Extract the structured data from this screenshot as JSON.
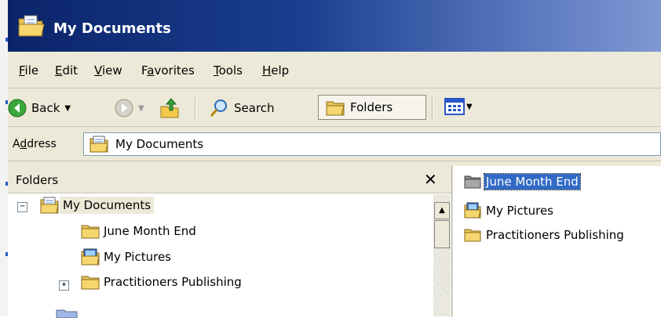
{
  "window": {
    "title": "My Documents",
    "title_icon": "folder-open-icon"
  },
  "menu": {
    "file": {
      "u": "F",
      "rest": "ile"
    },
    "edit": {
      "u": "E",
      "rest": "dit"
    },
    "view": {
      "u": "V",
      "rest": "iew"
    },
    "favorites": {
      "pre": "F",
      "u": "a",
      "rest": "vorites"
    },
    "tools": {
      "u": "T",
      "rest": "ools"
    },
    "help": {
      "u": "H",
      "rest": "elp"
    }
  },
  "toolbar": {
    "back_label": "Back",
    "search_label": "Search",
    "folders_label": "Folders"
  },
  "address": {
    "label_pre": "A",
    "label_u": "d",
    "label_rest": "dress",
    "value": "My Documents"
  },
  "folders_pane": {
    "header": "Folders",
    "close_symbol": "✕",
    "tree": [
      {
        "label": "My Documents",
        "expander": "⊟"
      },
      {
        "label": "June Month End"
      },
      {
        "label": "My Pictures"
      },
      {
        "label": "Practitioners Publishing",
        "expander": "⊞"
      }
    ]
  },
  "files": [
    {
      "name": "June Month End",
      "selected": true
    },
    {
      "name": "My Pictures"
    },
    {
      "name": "Practitioners Publishing"
    }
  ],
  "colors": {
    "title_gradient_start": "#0a246a",
    "title_gradient_end": "#7f98d2",
    "selection": "#316ac5",
    "chrome": "#ece9d8"
  }
}
